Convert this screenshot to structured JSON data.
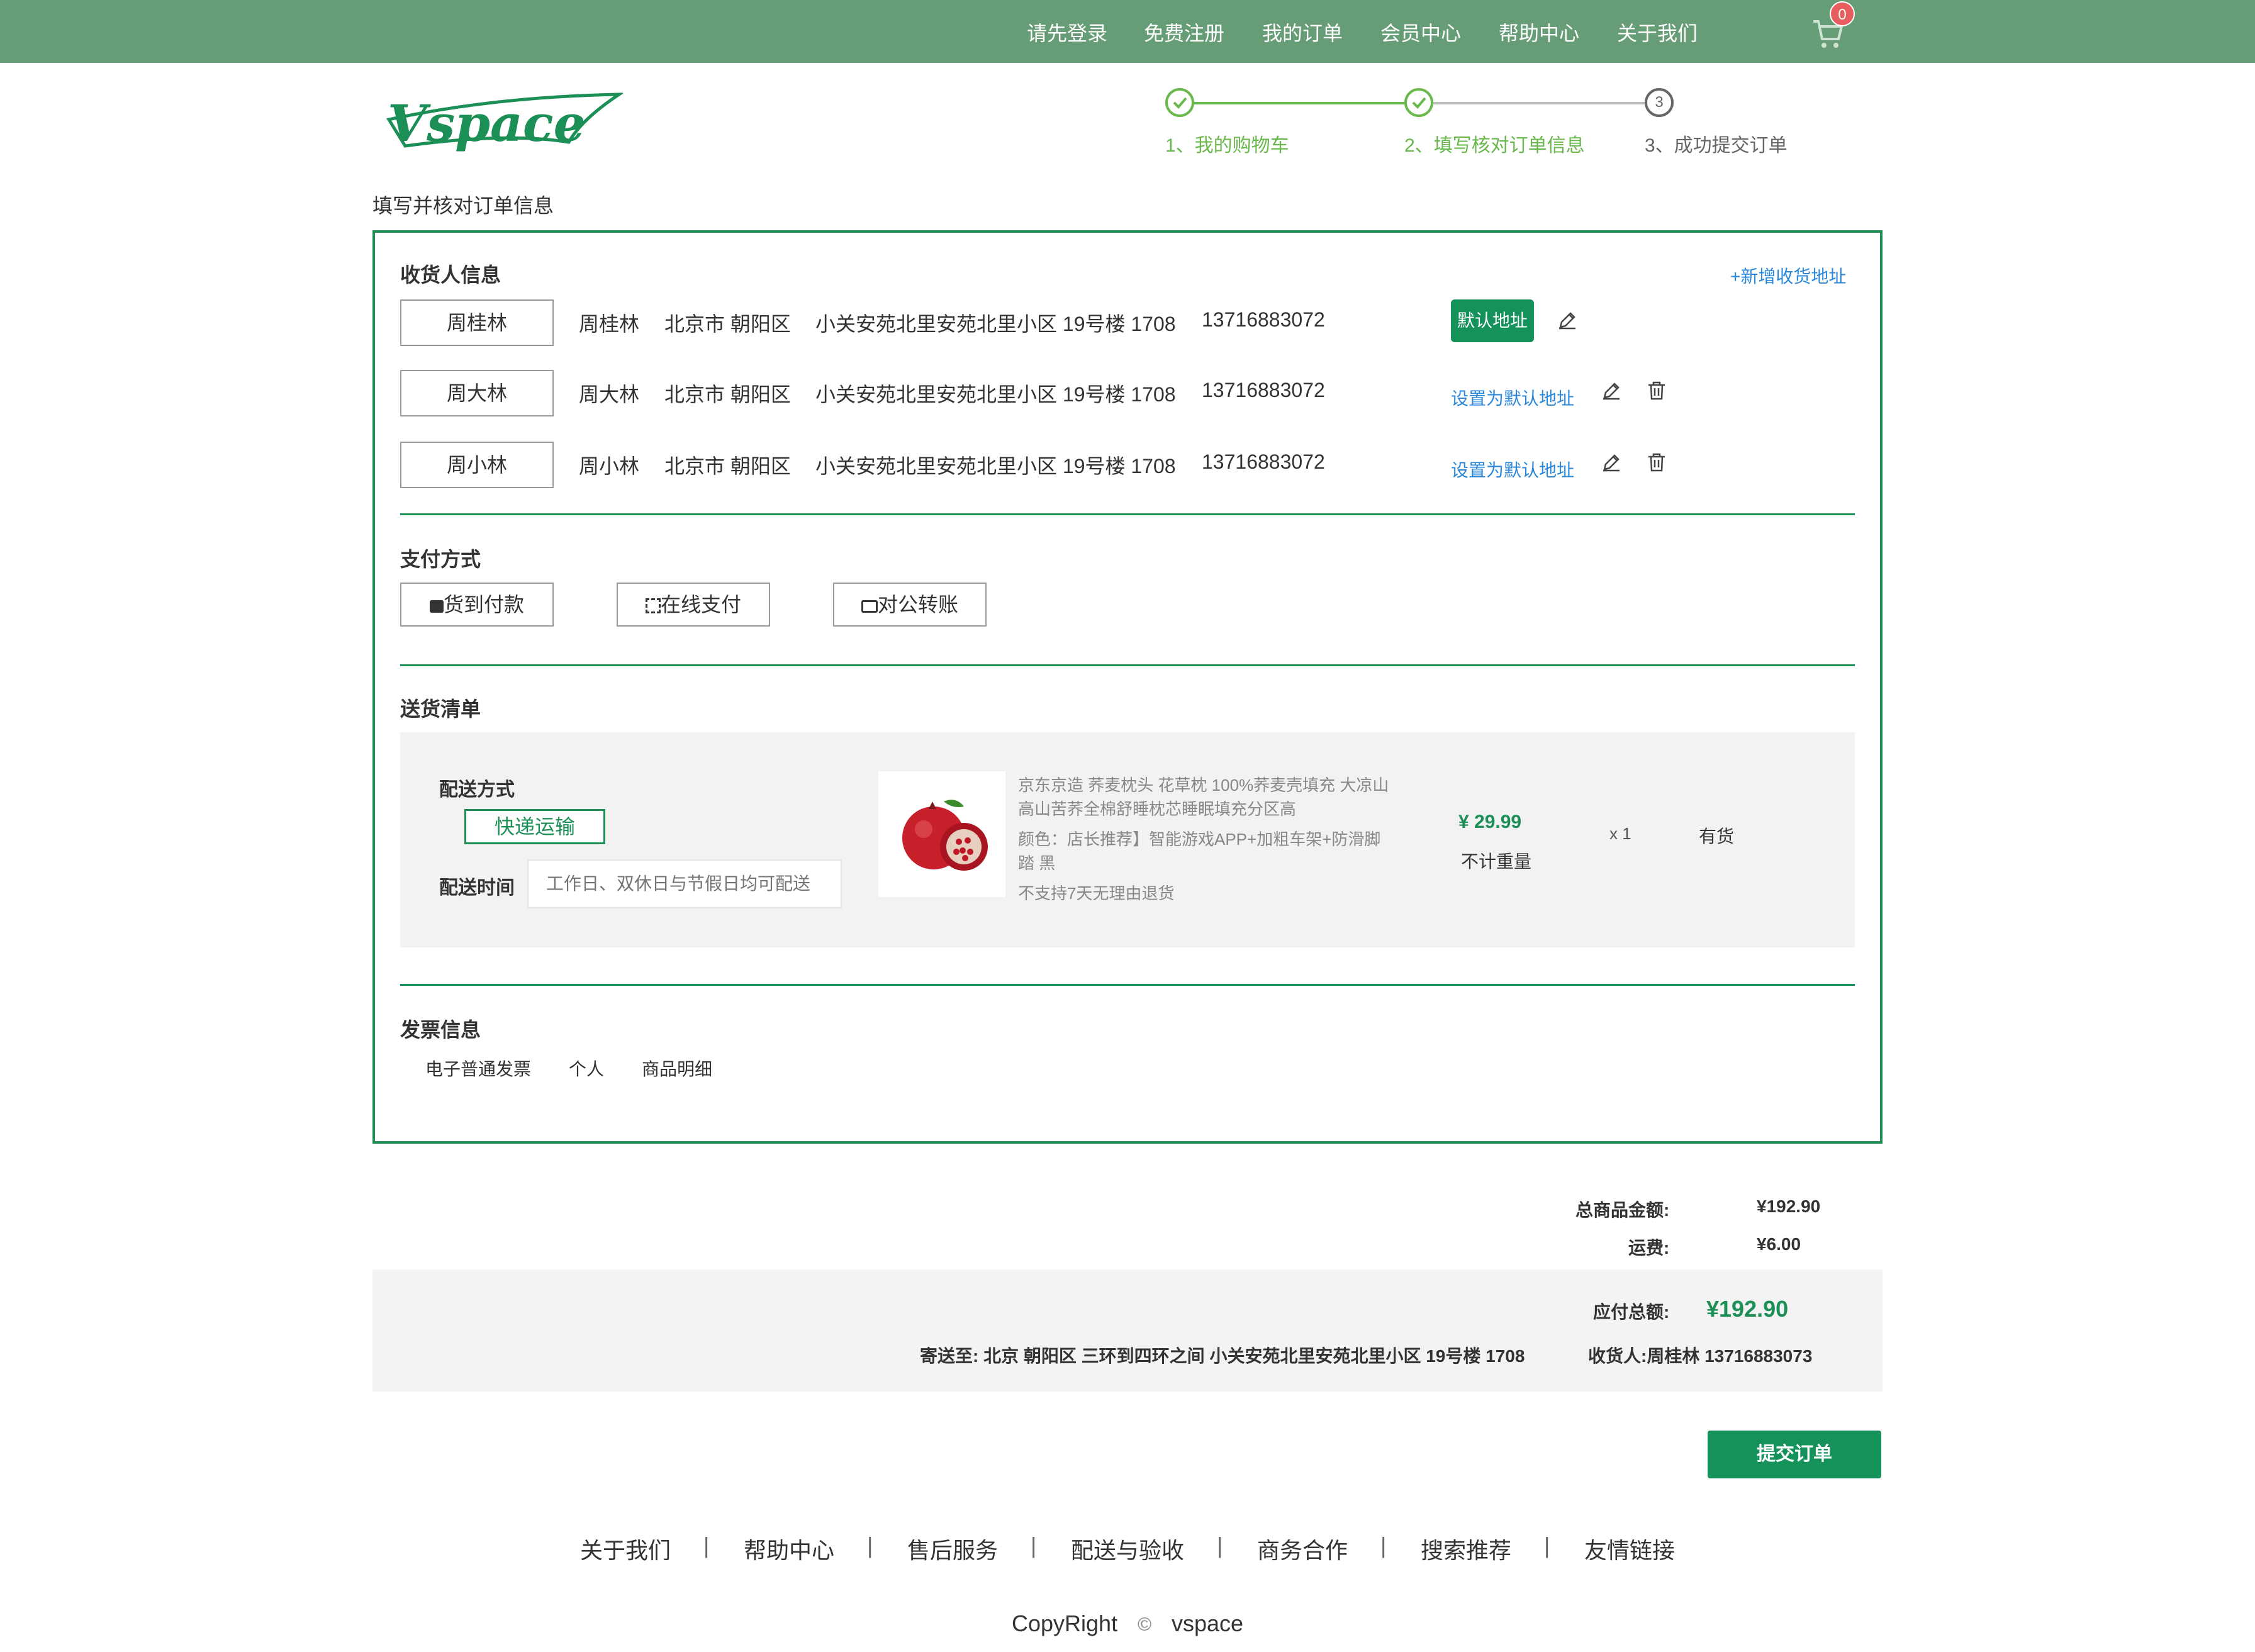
{
  "top_nav": {
    "items": [
      "请先登录",
      "免费注册",
      "我的订单",
      "会员中心",
      "帮助中心",
      "关于我们"
    ],
    "cart_count": "0",
    "bg_color": "#679d76"
  },
  "logo": {
    "text": "Vspace",
    "color": "#1c8f56"
  },
  "steps": [
    {
      "num": "",
      "label": "1、我的购物车",
      "state": "done"
    },
    {
      "num": "",
      "label": "2、填写核对订单信息",
      "state": "done"
    },
    {
      "num": "3",
      "label": "3、成功提交订单",
      "state": "todo"
    }
  ],
  "page_heading": "填写并核对订单信息",
  "receiver": {
    "title": "收货人信息",
    "add_link": "+新增收货地址",
    "addresses": [
      {
        "button": "周桂林",
        "name": "周桂林",
        "city": "北京市 朝阳区",
        "street": "小关安苑北里安苑北里小区 19号楼 1708",
        "phone": "13716883072",
        "default_label": "默认地址"
      },
      {
        "button": "周大林",
        "name": "周大林",
        "city": "北京市 朝阳区",
        "street": "小关安苑北里安苑北里小区 19号楼 1708",
        "phone": "13716883072",
        "set_default": "设置为默认地址"
      },
      {
        "button": "周小林",
        "name": "周小林",
        "city": "北京市 朝阳区",
        "street": "小关安苑北里安苑北里小区 19号楼 1708",
        "phone": "13716883072",
        "set_default": "设置为默认地址"
      }
    ]
  },
  "payment": {
    "title": "支付方式",
    "options": [
      "货到付款",
      "在线支付",
      "对公转账"
    ]
  },
  "delivery": {
    "title": "送货清单",
    "method_label": "配送方式",
    "method_value": "快递运输",
    "time_label": "配送时间",
    "time_placeholder": "工作日、双休日与节假日均可配送",
    "product": {
      "line1": "京东京造 荞麦枕头 花草枕 100%荞麦壳填充 大凉山",
      "line2": "高山苦荞全棉舒睡枕芯睡眠填充分区高",
      "line3": "颜色：店长推荐】智能游戏APP+加粗车架+防滑脚",
      "line4": "踏 黑",
      "line5": "不支持7天无理由退货",
      "price": "¥ 29.99",
      "weight": "不计重量",
      "qty": "x 1",
      "stock": "有货"
    }
  },
  "invoice": {
    "title": "发票信息",
    "items": [
      "电子普通发票",
      "个人",
      "商品明细"
    ]
  },
  "summary": {
    "goods_label": "总商品金额:",
    "goods_value": "¥192.90",
    "freight_label": "运费:",
    "freight_value": "¥6.00",
    "total_label": "应付总额:",
    "total_value": "¥192.90",
    "ship_to": "寄送至:  北京 朝阳区 三环到四环之间 小关安苑北里安苑北里小区 19号楼 1708",
    "receiver": "收货人:周桂林 13716883073"
  },
  "submit_label": "提交订单",
  "footer": {
    "links": [
      "关于我们",
      "帮助中心",
      "售后服务",
      "配送与验收",
      "商务合作",
      "搜索推荐",
      "友情链接"
    ],
    "copyright_left": "CopyRight",
    "copyright_symbol": "©",
    "copyright_right": "vspace"
  },
  "colors": {
    "accent": "#1c8f56",
    "link": "#2b87d9",
    "step_green": "#69b84b"
  }
}
